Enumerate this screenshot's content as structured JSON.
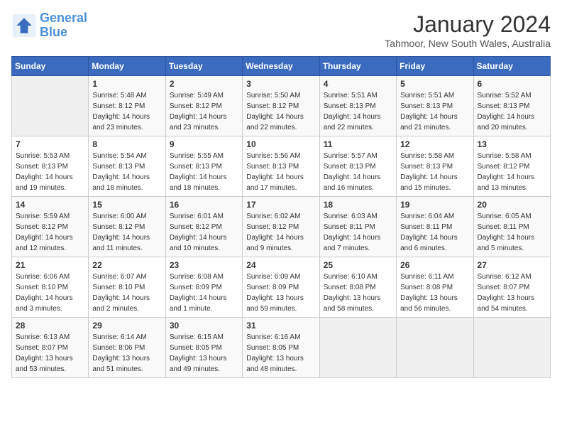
{
  "logo": {
    "line1": "General",
    "line2": "Blue"
  },
  "title": "January 2024",
  "subtitle": "Tahmoor, New South Wales, Australia",
  "days_of_week": [
    "Sunday",
    "Monday",
    "Tuesday",
    "Wednesday",
    "Thursday",
    "Friday",
    "Saturday"
  ],
  "weeks": [
    [
      {
        "day": "",
        "sunrise": "",
        "sunset": "",
        "daylight": ""
      },
      {
        "day": "1",
        "sunrise": "Sunrise: 5:48 AM",
        "sunset": "Sunset: 8:12 PM",
        "daylight": "Daylight: 14 hours and 23 minutes."
      },
      {
        "day": "2",
        "sunrise": "Sunrise: 5:49 AM",
        "sunset": "Sunset: 8:12 PM",
        "daylight": "Daylight: 14 hours and 23 minutes."
      },
      {
        "day": "3",
        "sunrise": "Sunrise: 5:50 AM",
        "sunset": "Sunset: 8:12 PM",
        "daylight": "Daylight: 14 hours and 22 minutes."
      },
      {
        "day": "4",
        "sunrise": "Sunrise: 5:51 AM",
        "sunset": "Sunset: 8:13 PM",
        "daylight": "Daylight: 14 hours and 22 minutes."
      },
      {
        "day": "5",
        "sunrise": "Sunrise: 5:51 AM",
        "sunset": "Sunset: 8:13 PM",
        "daylight": "Daylight: 14 hours and 21 minutes."
      },
      {
        "day": "6",
        "sunrise": "Sunrise: 5:52 AM",
        "sunset": "Sunset: 8:13 PM",
        "daylight": "Daylight: 14 hours and 20 minutes."
      }
    ],
    [
      {
        "day": "7",
        "sunrise": "Sunrise: 5:53 AM",
        "sunset": "Sunset: 8:13 PM",
        "daylight": "Daylight: 14 hours and 19 minutes."
      },
      {
        "day": "8",
        "sunrise": "Sunrise: 5:54 AM",
        "sunset": "Sunset: 8:13 PM",
        "daylight": "Daylight: 14 hours and 18 minutes."
      },
      {
        "day": "9",
        "sunrise": "Sunrise: 5:55 AM",
        "sunset": "Sunset: 8:13 PM",
        "daylight": "Daylight: 14 hours and 18 minutes."
      },
      {
        "day": "10",
        "sunrise": "Sunrise: 5:56 AM",
        "sunset": "Sunset: 8:13 PM",
        "daylight": "Daylight: 14 hours and 17 minutes."
      },
      {
        "day": "11",
        "sunrise": "Sunrise: 5:57 AM",
        "sunset": "Sunset: 8:13 PM",
        "daylight": "Daylight: 14 hours and 16 minutes."
      },
      {
        "day": "12",
        "sunrise": "Sunrise: 5:58 AM",
        "sunset": "Sunset: 8:13 PM",
        "daylight": "Daylight: 14 hours and 15 minutes."
      },
      {
        "day": "13",
        "sunrise": "Sunrise: 5:58 AM",
        "sunset": "Sunset: 8:12 PM",
        "daylight": "Daylight: 14 hours and 13 minutes."
      }
    ],
    [
      {
        "day": "14",
        "sunrise": "Sunrise: 5:59 AM",
        "sunset": "Sunset: 8:12 PM",
        "daylight": "Daylight: 14 hours and 12 minutes."
      },
      {
        "day": "15",
        "sunrise": "Sunrise: 6:00 AM",
        "sunset": "Sunset: 8:12 PM",
        "daylight": "Daylight: 14 hours and 11 minutes."
      },
      {
        "day": "16",
        "sunrise": "Sunrise: 6:01 AM",
        "sunset": "Sunset: 8:12 PM",
        "daylight": "Daylight: 14 hours and 10 minutes."
      },
      {
        "day": "17",
        "sunrise": "Sunrise: 6:02 AM",
        "sunset": "Sunset: 8:12 PM",
        "daylight": "Daylight: 14 hours and 9 minutes."
      },
      {
        "day": "18",
        "sunrise": "Sunrise: 6:03 AM",
        "sunset": "Sunset: 8:11 PM",
        "daylight": "Daylight: 14 hours and 7 minutes."
      },
      {
        "day": "19",
        "sunrise": "Sunrise: 6:04 AM",
        "sunset": "Sunset: 8:11 PM",
        "daylight": "Daylight: 14 hours and 6 minutes."
      },
      {
        "day": "20",
        "sunrise": "Sunrise: 6:05 AM",
        "sunset": "Sunset: 8:11 PM",
        "daylight": "Daylight: 14 hours and 5 minutes."
      }
    ],
    [
      {
        "day": "21",
        "sunrise": "Sunrise: 6:06 AM",
        "sunset": "Sunset: 8:10 PM",
        "daylight": "Daylight: 14 hours and 3 minutes."
      },
      {
        "day": "22",
        "sunrise": "Sunrise: 6:07 AM",
        "sunset": "Sunset: 8:10 PM",
        "daylight": "Daylight: 14 hours and 2 minutes."
      },
      {
        "day": "23",
        "sunrise": "Sunrise: 6:08 AM",
        "sunset": "Sunset: 8:09 PM",
        "daylight": "Daylight: 14 hours and 1 minute."
      },
      {
        "day": "24",
        "sunrise": "Sunrise: 6:09 AM",
        "sunset": "Sunset: 8:09 PM",
        "daylight": "Daylight: 13 hours and 59 minutes."
      },
      {
        "day": "25",
        "sunrise": "Sunrise: 6:10 AM",
        "sunset": "Sunset: 8:08 PM",
        "daylight": "Daylight: 13 hours and 58 minutes."
      },
      {
        "day": "26",
        "sunrise": "Sunrise: 6:11 AM",
        "sunset": "Sunset: 8:08 PM",
        "daylight": "Daylight: 13 hours and 56 minutes."
      },
      {
        "day": "27",
        "sunrise": "Sunrise: 6:12 AM",
        "sunset": "Sunset: 8:07 PM",
        "daylight": "Daylight: 13 hours and 54 minutes."
      }
    ],
    [
      {
        "day": "28",
        "sunrise": "Sunrise: 6:13 AM",
        "sunset": "Sunset: 8:07 PM",
        "daylight": "Daylight: 13 hours and 53 minutes."
      },
      {
        "day": "29",
        "sunrise": "Sunrise: 6:14 AM",
        "sunset": "Sunset: 8:06 PM",
        "daylight": "Daylight: 13 hours and 51 minutes."
      },
      {
        "day": "30",
        "sunrise": "Sunrise: 6:15 AM",
        "sunset": "Sunset: 8:05 PM",
        "daylight": "Daylight: 13 hours and 49 minutes."
      },
      {
        "day": "31",
        "sunrise": "Sunrise: 6:16 AM",
        "sunset": "Sunset: 8:05 PM",
        "daylight": "Daylight: 13 hours and 48 minutes."
      },
      {
        "day": "",
        "sunrise": "",
        "sunset": "",
        "daylight": ""
      },
      {
        "day": "",
        "sunrise": "",
        "sunset": "",
        "daylight": ""
      },
      {
        "day": "",
        "sunrise": "",
        "sunset": "",
        "daylight": ""
      }
    ]
  ]
}
